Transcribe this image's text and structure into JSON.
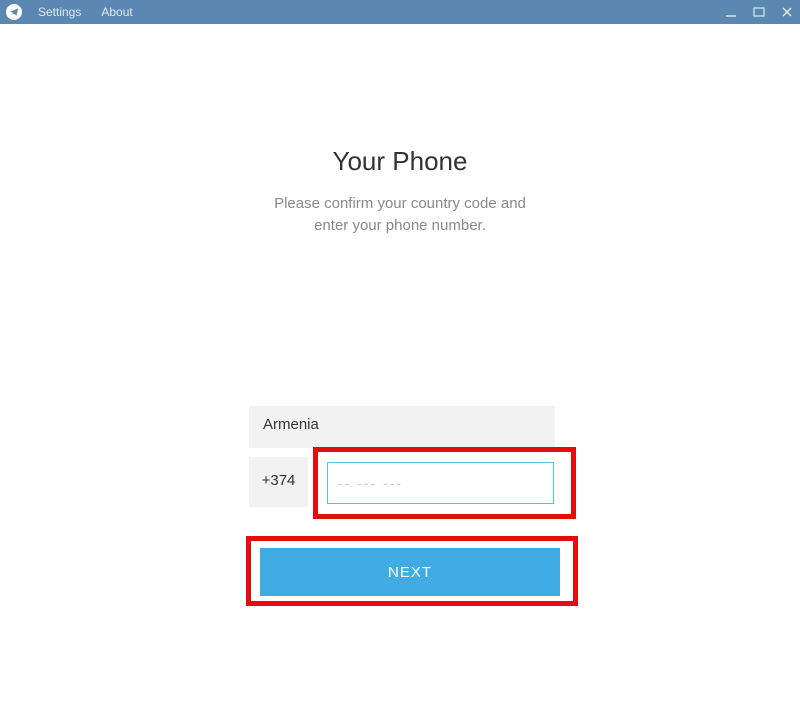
{
  "titlebar": {
    "menu": {
      "settings": "Settings",
      "about": "About"
    }
  },
  "main": {
    "title": "Your Phone",
    "subtitle_line1": "Please confirm your country code and",
    "subtitle_line2": "enter your phone number.",
    "country_value": "Armenia",
    "code_value": "+374",
    "phone_placeholder": "-- --- ---",
    "phone_value": "",
    "next_label": "NEXT"
  }
}
